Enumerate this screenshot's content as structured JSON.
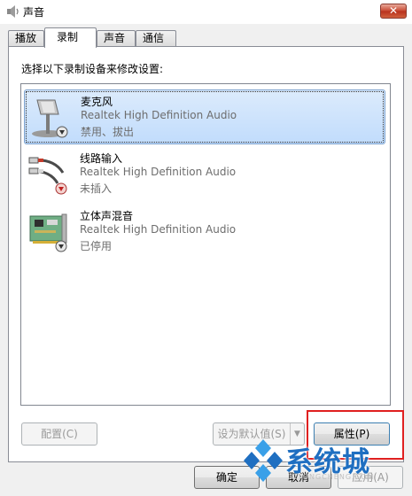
{
  "window": {
    "title": "声音",
    "close_glyph": "✕"
  },
  "tabs": [
    {
      "label": "播放",
      "active": false
    },
    {
      "label": "录制",
      "active": true
    },
    {
      "label": "声音",
      "active": false
    },
    {
      "label": "通信",
      "active": false
    }
  ],
  "panel": {
    "instruction": "选择以下录制设备来修改设置:"
  },
  "devices": [
    {
      "name": "麦克风",
      "driver": "Realtek High Definition Audio",
      "status": "禁用、拔出",
      "icon": "microphone-icon",
      "badge": "down-arrow-gray",
      "selected": true
    },
    {
      "name": "线路输入",
      "driver": "Realtek High Definition Audio",
      "status": "未插入",
      "icon": "line-in-cable-icon",
      "badge": "down-arrow-red",
      "selected": false
    },
    {
      "name": "立体声混音",
      "driver": "Realtek High Definition Audio",
      "status": "已停用",
      "icon": "sound-card-icon",
      "badge": "down-arrow-gray",
      "selected": false
    }
  ],
  "buttons": {
    "configure": "配置(C)",
    "set_default": "设为默认值(S)",
    "properties": "属性(P)",
    "ok": "确定",
    "cancel": "取消",
    "apply": "应用(A)"
  },
  "watermark": {
    "text": "系统城",
    "sub": "XITONGCHENG.COM"
  },
  "colors": {
    "selection": "#c1dcfc",
    "highlight_box": "#e02020",
    "watermark": "#1f6fc1"
  }
}
